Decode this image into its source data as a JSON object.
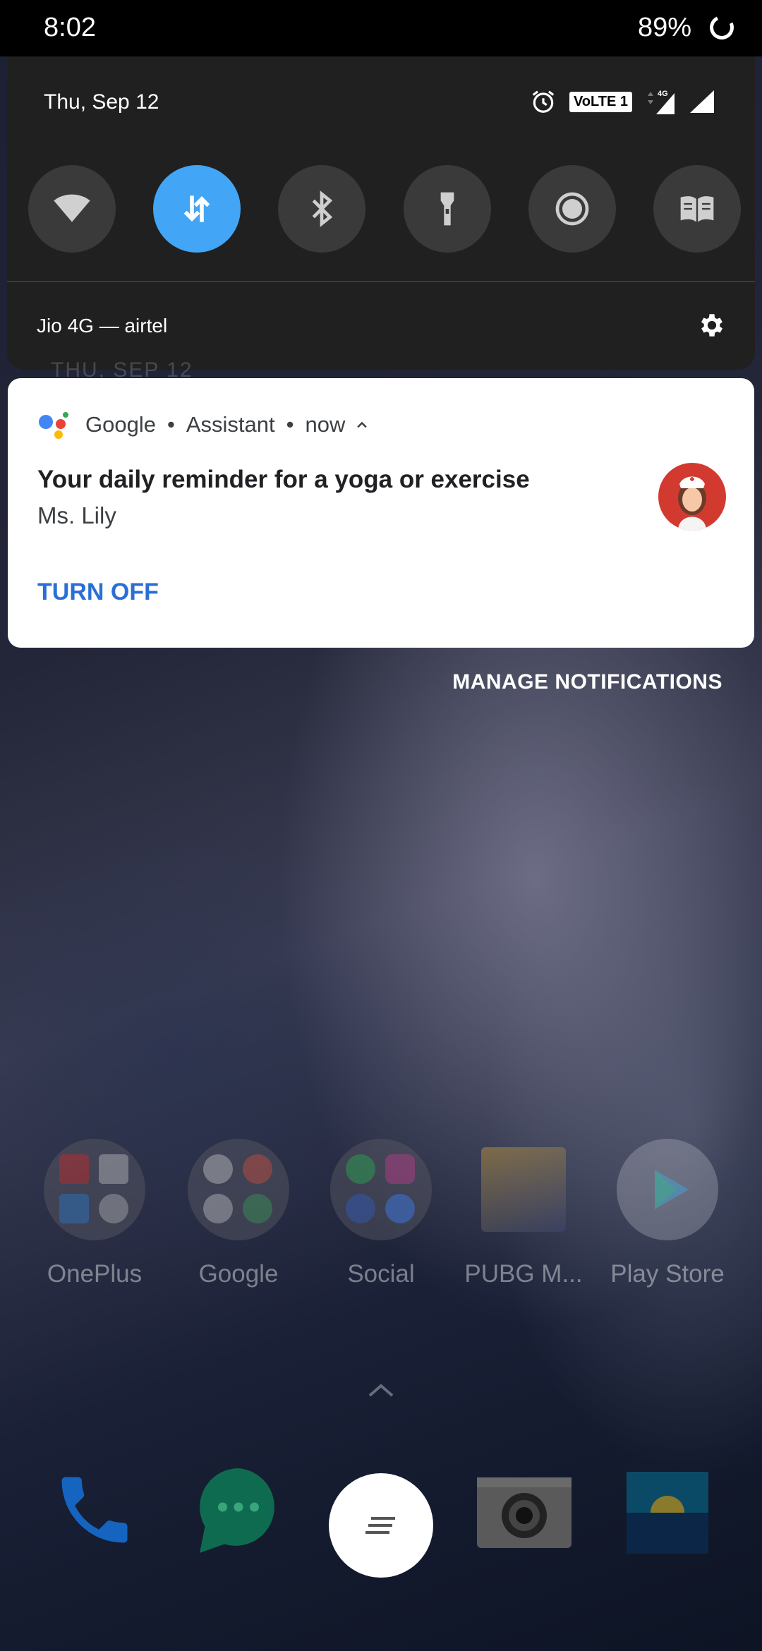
{
  "status_bar": {
    "time": "8:02",
    "battery": "89%"
  },
  "quick_settings": {
    "date": "Thu, Sep 12",
    "volte_label": "VoLTE 1",
    "network_label": "4G",
    "tiles": [
      {
        "name": "wifi",
        "icon": "wifi-icon",
        "active": false
      },
      {
        "name": "mobile-data",
        "icon": "data-transfer-icon",
        "active": true
      },
      {
        "name": "bluetooth",
        "icon": "bluetooth-icon",
        "active": false
      },
      {
        "name": "flashlight",
        "icon": "flashlight-icon",
        "active": false
      },
      {
        "name": "screen-record",
        "icon": "record-icon",
        "active": false
      },
      {
        "name": "reading-mode",
        "icon": "book-icon",
        "active": false
      }
    ],
    "carrier": "Jio 4G — airtel"
  },
  "notification": {
    "app": "Google",
    "source": "Assistant",
    "time": "now",
    "title": "Your daily reminder for a yoga or exercise",
    "text": "Ms. Lily",
    "action": "TURN OFF"
  },
  "manage_label": "MANAGE NOTIFICATIONS",
  "home": {
    "apps": [
      {
        "label": "OnePlus"
      },
      {
        "label": "Google"
      },
      {
        "label": "Social"
      },
      {
        "label": "PUBG M..."
      },
      {
        "label": "Play Store"
      }
    ]
  },
  "colors": {
    "accent_tile": "#42a5f5",
    "turn_off": "#2a6fd6",
    "panel": "#202020"
  }
}
